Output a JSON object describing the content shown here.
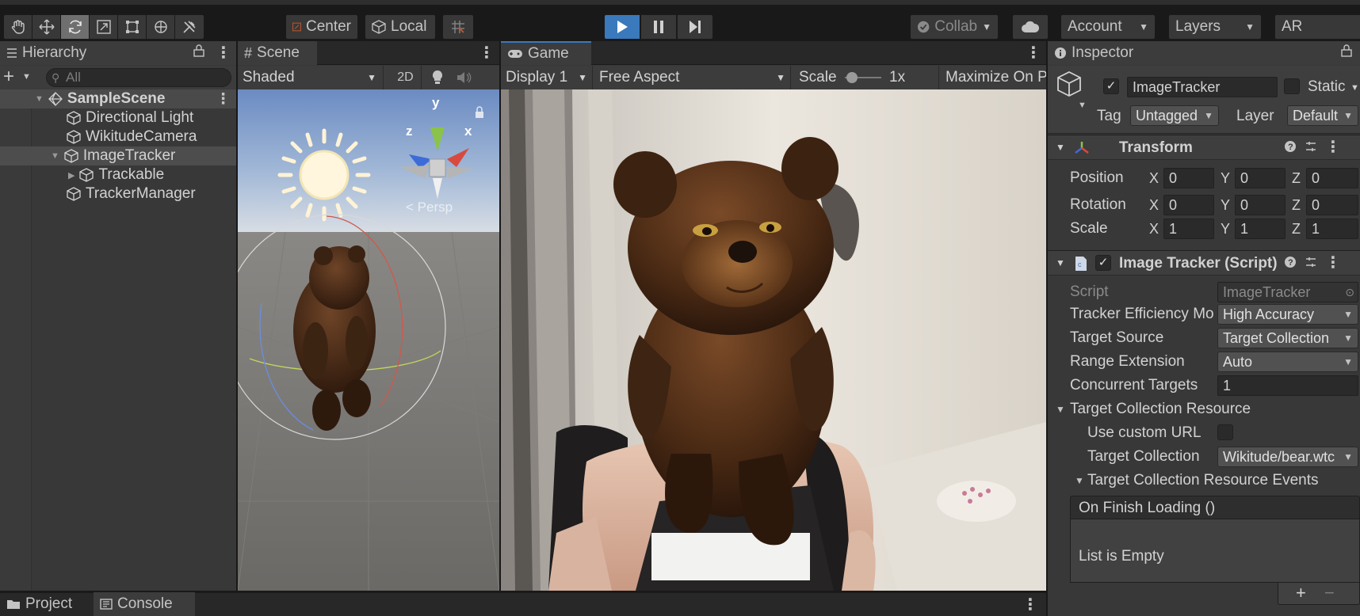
{
  "toolbar": {
    "tools": [
      "hand-tool",
      "move-tool",
      "rotate-tool",
      "scale-tool",
      "rect-tool",
      "transform-tool",
      "custom-tool"
    ],
    "active_tool": "rotate-tool",
    "pivot_label": "Center",
    "space_label": "Local",
    "collab_label": "Collab",
    "account_label": "Account",
    "layers_label": "Layers",
    "layout_label": "AR"
  },
  "hierarchy": {
    "tab_label": "Hierarchy",
    "search_placeholder": "All",
    "items": [
      {
        "label": "SampleScene",
        "depth": 0,
        "type": "scene"
      },
      {
        "label": "Directional Light",
        "depth": 1
      },
      {
        "label": "WikitudeCamera",
        "depth": 1
      },
      {
        "label": "ImageTracker",
        "depth": 1,
        "expanded": true
      },
      {
        "label": "Trackable",
        "depth": 2
      },
      {
        "label": "TrackerManager",
        "depth": 1
      }
    ]
  },
  "scene": {
    "tab_label": "Scene",
    "shading_mode": "Shaded",
    "mode_2d": "2D",
    "gizmo_y": "y",
    "gizmo_x": "x",
    "gizmo_z": "z",
    "projection": "< Persp"
  },
  "game": {
    "tab_label": "Game",
    "display": "Display 1",
    "aspect": "Free Aspect",
    "scale_label": "Scale",
    "scale_value": "1x",
    "maximize_label": "Maximize On P"
  },
  "inspector": {
    "tab_label": "Inspector",
    "object_name": "ImageTracker",
    "active": true,
    "static_label": "Static",
    "tag_label": "Tag",
    "tag_value": "Untagged",
    "layer_label": "Layer",
    "layer_value": "Default",
    "transform": {
      "title": "Transform",
      "position_label": "Position",
      "rotation_label": "Rotation",
      "scale_label": "Scale",
      "position": {
        "x": "0",
        "y": "0",
        "z": "0"
      },
      "rotation": {
        "x": "0",
        "y": "0",
        "z": "0"
      },
      "scale": {
        "x": "1",
        "y": "1",
        "z": "1"
      }
    },
    "script_component": {
      "title": "Image Tracker (Script)",
      "script_label": "Script",
      "script_value": "ImageTracker",
      "efficiency_label": "Tracker Efficiency Mo",
      "efficiency_value": "High Accuracy",
      "target_source_label": "Target Source",
      "target_source_value": "Target Collection",
      "range_label": "Range Extension",
      "range_value": "Auto",
      "concurrent_label": "Concurrent Targets",
      "concurrent_value": "1",
      "resource_label": "Target Collection Resource",
      "custom_url_label": "Use custom URL",
      "collection_label": "Target Collection",
      "collection_value": "Wikitude/bear.wtc",
      "events_label": "Target Collection Resource Events",
      "event_name": "On Finish Loading ()",
      "empty_label": "List is Empty"
    }
  },
  "bottom": {
    "project_label": "Project",
    "console_label": "Console"
  },
  "colors": {
    "accent": "#3a79bb",
    "panel": "#383838",
    "header": "#282828"
  }
}
